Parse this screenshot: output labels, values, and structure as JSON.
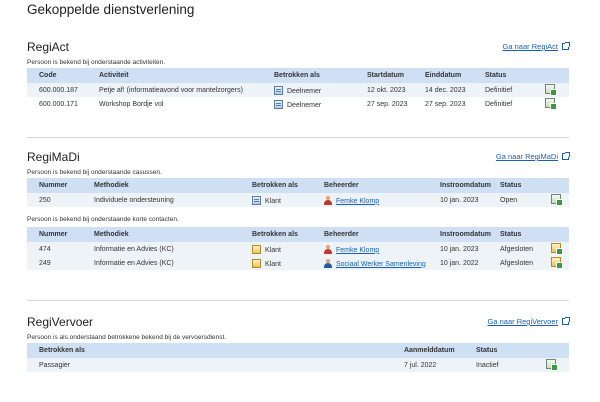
{
  "page_title": "Gekoppelde dienstverlening",
  "regiact": {
    "title": "RegiAct",
    "link": "Ga naar RegiAct",
    "note": "Persoon is bekend bij onderstaande activiteiten.",
    "headers": [
      "Code",
      "Activiteit",
      "Betrokken als",
      "Startdatum",
      "Einddatum",
      "Status"
    ],
    "rows": [
      {
        "code": "600.000.187",
        "activiteit": "Petje af! (informatieavond voor mantelzorgers)",
        "betrokken": "Deelnemer",
        "start": "12 okt. 2023",
        "eind": "14 dec. 2023",
        "status": "Definitief"
      },
      {
        "code": "600.000.171",
        "activiteit": "Workshop Bordje vol",
        "betrokken": "Deelnemer",
        "start": "27 sep. 2023",
        "eind": "27 sep. 2023",
        "status": "Definitief"
      }
    ]
  },
  "regimadi": {
    "title": "RegiMaDi",
    "link": "Ga naar RegiMaDi",
    "note1": "Persoon is bekend bij onderstaande casussen.",
    "headers": [
      "Nummer",
      "Methodiek",
      "Betrokken als",
      "Beheerder",
      "Instroomdatum",
      "Status"
    ],
    "casussen": [
      {
        "nummer": "250",
        "methodiek": "Individuele ondersteuning",
        "betrokken": "Klant",
        "beheerder": "Femke Klomp",
        "datum": "10 jan. 2023",
        "status": "Open"
      }
    ],
    "note2": "Persoon is bekend bij onderstaande korte contacten.",
    "contacten": [
      {
        "nummer": "474",
        "methodiek": "Informatie en Advies (KC)",
        "betrokken": "Klant",
        "beheerder": "Femke Klomp",
        "datum": "10 jan. 2023",
        "status": "Afgesloten"
      },
      {
        "nummer": "249",
        "methodiek": "Informatie en Advies (KC)",
        "betrokken": "Klant",
        "beheerder": "Sociaal Werker Samenleving",
        "datum": "10 jan. 2022",
        "status": "Afgesloten"
      }
    ]
  },
  "regivervoer": {
    "title": "RegiVervoer",
    "link": "Ga naar RegiVervoer",
    "note": "Persoon is als onderstaand betrokkene bekend bij de vervoersdienst.",
    "headers": [
      "Betrokken als",
      "Aanmelddatum",
      "Status"
    ],
    "rows": [
      {
        "betrokken": "Passagier",
        "datum": "7 jul. 2022",
        "status": "Inactief"
      }
    ]
  }
}
